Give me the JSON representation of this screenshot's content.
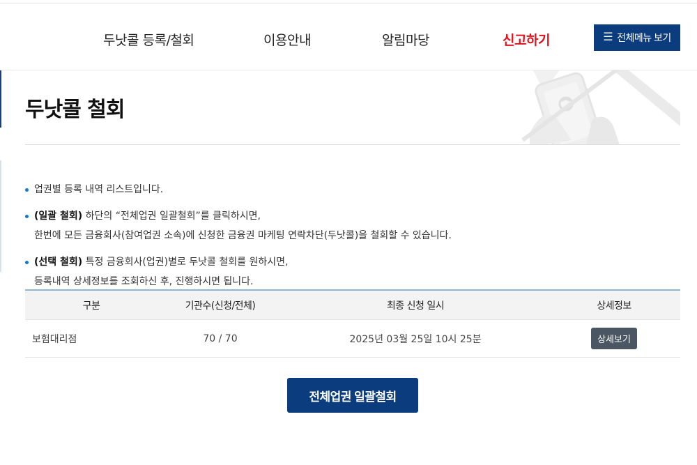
{
  "nav": {
    "items": [
      {
        "label": "두낫콜 등록/철회"
      },
      {
        "label": "이용안내"
      },
      {
        "label": "알림마당"
      },
      {
        "label": "신고하기"
      }
    ],
    "menu_button": "전체메뉴 보기"
  },
  "page": {
    "title": "두낫콜 철회"
  },
  "bullets": [
    {
      "strong": "",
      "line1": "업권별 등록 내역 리스트입니다.",
      "line2": ""
    },
    {
      "strong": "(일괄 철회)",
      "line1": " 하단의 “전체업권 일괄철회”를 클릭하시면,",
      "line2": "한번에 모든 금융회사(참여업권 소속)에 신청한 금융권 마케팅 연락차단(두낫콜)을 철회할 수 있습니다."
    },
    {
      "strong": "(선택 철회)",
      "line1": " 특정 금융회사(업권)별로 두낫콜 철회를 원하시면,",
      "line2": "등록내역 상세정보를 조회하신 후, 진행하시면 됩니다."
    }
  ],
  "table": {
    "headers": [
      "구분",
      "기관수(신청/전체)",
      "최종 신청 일시",
      "상세정보"
    ],
    "rows": [
      {
        "category": "보험대리점",
        "count": "70 / 70",
        "datetime": "2025년 03월 25일 10시 25분",
        "detail_button": "상세보기"
      }
    ]
  },
  "bulk_withdraw_button": "전체업권 일괄철회",
  "colors": {
    "brand": "#0b3d7e",
    "report": "#e0131d",
    "bullet": "#1877c9"
  }
}
